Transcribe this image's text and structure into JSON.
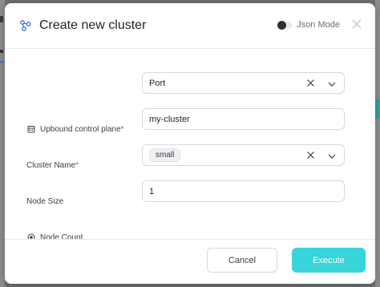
{
  "dialog": {
    "title": "Create new cluster",
    "json_mode_label": "Json Mode",
    "json_mode_on": false
  },
  "fields": [
    {
      "label": "Upbound control plane",
      "required": true,
      "type": "select",
      "value": "Port",
      "icon": "building-icon"
    },
    {
      "label": "Cluster Name",
      "required": true,
      "type": "text",
      "value": "my-cluster"
    },
    {
      "label": "Node Size",
      "required": false,
      "type": "select",
      "value": "small"
    },
    {
      "label": "Node Count",
      "required": false,
      "type": "number",
      "value": "1",
      "icon": "radio-dot-icon"
    }
  ],
  "footer": {
    "cancel_label": "Cancel",
    "execute_label": "Execute"
  },
  "colors": {
    "accent": "#37d4d9",
    "required": "#d64545"
  }
}
